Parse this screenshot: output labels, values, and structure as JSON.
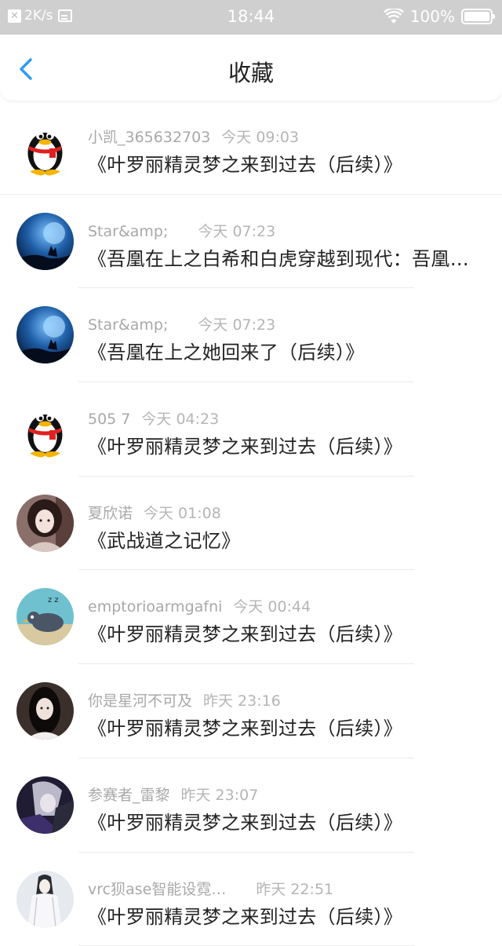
{
  "status_bar": {
    "network_speed": "2K/s",
    "time": "18:44",
    "battery": "100%",
    "icons": [
      "notification-x-icon",
      "image-icon",
      "wifi-icon",
      "battery-icon"
    ]
  },
  "nav": {
    "title": "收藏",
    "back_icon": "chevron-left-icon",
    "accent_color": "#2f9bf0"
  },
  "items": [
    {
      "user": "小凯_365632703",
      "time": "今天 09:03",
      "title": "《叶罗丽精灵梦之来到过去（后续）》",
      "avatar": "qq-penguin"
    },
    {
      "user": "Star&amp;",
      "time": "今天 07:23",
      "title": "《吾凰在上之白希和白虎穿越到现代：吾凰…",
      "avatar": "night-sky-wolf"
    },
    {
      "user": "Star&amp;",
      "time": "今天 07:23",
      "title": "《吾凰在上之她回来了（后续）》",
      "avatar": "night-sky-wolf"
    },
    {
      "user": "505 7",
      "time": "今天 04:23",
      "title": "《叶罗丽精灵梦之来到过去（后续）》",
      "avatar": "qq-penguin"
    },
    {
      "user": "夏欣诺",
      "time": "今天 01:08",
      "title": "《武战道之记忆》",
      "avatar": "girl-portrait"
    },
    {
      "user": "emptorioarmgafni",
      "time": "今天 00:44",
      "title": "《叶罗丽精灵梦之来到过去（后续）》",
      "avatar": "cartoon-bird"
    },
    {
      "user": "你是星河不可及",
      "time": "昨天 23:16",
      "title": "《叶罗丽精灵梦之来到过去（后续）》",
      "avatar": "girl-dark-hair"
    },
    {
      "user": "参赛者_雷黎",
      "time": "昨天 23:07",
      "title": "《叶罗丽精灵梦之来到过去（后续）》",
      "avatar": "anime-dark"
    },
    {
      "user": "vrc狈ase智能设霓…",
      "time": "昨天 22:51",
      "title": "《叶罗丽精灵梦之来到过去（后续）》",
      "avatar": "anime-white-robe"
    }
  ]
}
